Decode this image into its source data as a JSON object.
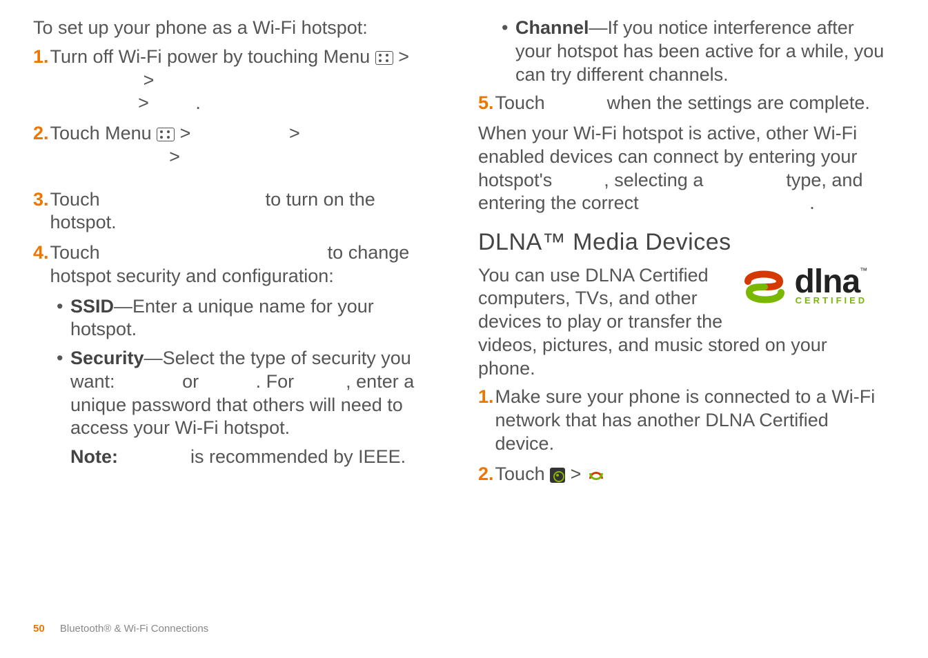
{
  "left": {
    "intro": "To set up your phone as a Wi-Fi hotspot:",
    "steps": [
      {
        "num": "1.",
        "parts": [
          "Turn off Wi-Fi power by touching Menu",
          ">",
          ">",
          ">",
          "."
        ]
      },
      {
        "num": "2.",
        "parts": [
          "Touch Menu",
          ">",
          ">",
          ">"
        ]
      },
      {
        "num": "3.",
        "pre": "Touch",
        "post": "to turn on the hotspot."
      },
      {
        "num": "4.",
        "pre": "Touch",
        "post": "to change hotspot security and configuration:"
      }
    ],
    "bullets": [
      {
        "label": "SSID",
        "text": "—Enter a unique name for your hotspot."
      },
      {
        "label": "Security",
        "text_pre": "—Select the type of security you want:",
        "or": "or",
        "for": ". For",
        "text_post": ", enter a unique password that others will need to access your Wi-Fi hotspot."
      }
    ],
    "note_label": "Note:",
    "note_text": "is recommended by IEEE."
  },
  "right": {
    "bullets": [
      {
        "label": "Channel",
        "text": "—If you notice interference after your hotspot has been active for a while, you can try different channels."
      }
    ],
    "step5": {
      "num": "5.",
      "pre": "Touch",
      "post": "when the settings are complete."
    },
    "para_parts": {
      "a": "When your Wi-Fi hotspot is active, other Wi-Fi enabled devices can connect by entering your hotspot's",
      "b": ", selecting a",
      "c": "type, and entering the correct",
      "d": "."
    },
    "section_heading": "DLNA™ Media Devices",
    "dlna_intro": "You can use DLNA Certified computers, TVs, and other devices to play or transfer the videos, pictures, and music stored on your phone.",
    "dlna_steps": [
      {
        "num": "1.",
        "text": "Make sure your phone is connected to a Wi-Fi network that has another DLNA Certified device."
      },
      {
        "num": "2.",
        "pre": "Touch",
        "mid": ">"
      }
    ],
    "logo": {
      "text": "dlna",
      "tm": "™",
      "cert": "CERTIFIED"
    }
  },
  "footer": {
    "page": "50",
    "title": "Bluetooth® & Wi-Fi Connections"
  }
}
